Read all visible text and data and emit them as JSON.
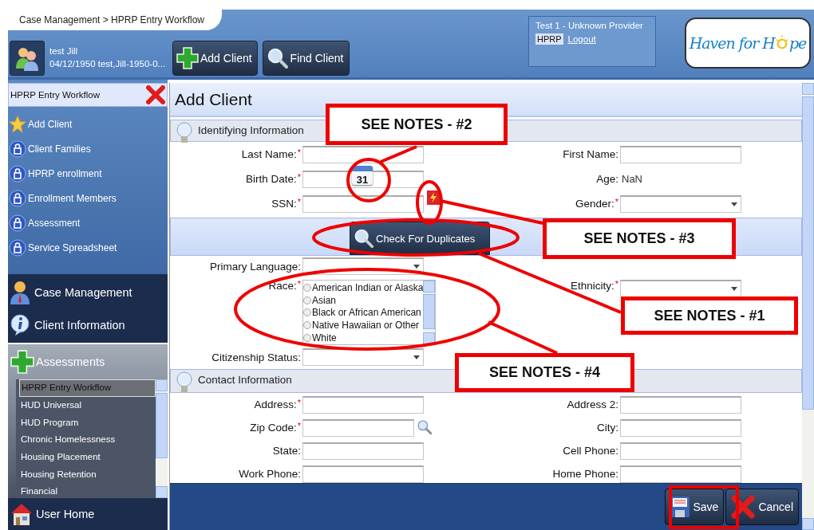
{
  "breadcrumb": "Case Management > HPRP Entry Workflow",
  "client": {
    "name": "test Jill",
    "details": "04/12/1950 test,Jill-1950-0..."
  },
  "toolbar": [
    {
      "label": "Add Client",
      "kind": "add"
    },
    {
      "label": "Find Client",
      "kind": "find"
    }
  ],
  "provider": {
    "name": "Test 1 - Unknown Provider",
    "badge": "HPRP",
    "link": "Logout"
  },
  "logo": {
    "before": "Haven for H",
    "after": "pe"
  },
  "workflow": {
    "title": "HPRP Entry Workflow",
    "items": [
      {
        "label": "Add Client",
        "kind": "star"
      },
      {
        "label": "Client Families",
        "kind": "lock"
      },
      {
        "label": "HPRP enrollment",
        "kind": "lock"
      },
      {
        "label": "Enrollment Members",
        "kind": "lock"
      },
      {
        "label": "Assessment",
        "kind": "lock"
      },
      {
        "label": "Service Spreadsheet",
        "kind": "lock"
      }
    ]
  },
  "nav": [
    {
      "label": "Case Management",
      "kind": "person"
    },
    {
      "label": "Client Information",
      "kind": "info"
    }
  ],
  "assessments": {
    "title": "Assessments",
    "items": [
      {
        "label": "HPRP Entry Workflow",
        "selected": true
      },
      {
        "label": "HUD Universal",
        "selected": false
      },
      {
        "label": "HUD Program",
        "selected": false
      },
      {
        "label": "Chronic Homelessness",
        "selected": false
      },
      {
        "label": "Housing Placement",
        "selected": false
      },
      {
        "label": "Housing Retention",
        "selected": false
      },
      {
        "label": "Financial",
        "selected": false
      }
    ]
  },
  "home": "User Home",
  "page_title": "Add Client",
  "identifying": {
    "title": "Identifying Information",
    "rows": [
      {
        "left": {
          "label": "Last Name:",
          "marker": "*",
          "kind": "text"
        },
        "right": {
          "label": "First Name:",
          "kind": "text"
        }
      },
      {
        "left": {
          "label": "Birth Date:",
          "marker": "*",
          "kind": "date",
          "icon_text": "31"
        },
        "right": {
          "label": "Age:",
          "kind": "value",
          "value": "NaN"
        }
      },
      {
        "left": {
          "label": "SSN:",
          "marker": "*",
          "kind": "ssn"
        },
        "right": {
          "label": "Gender:",
          "marker": "*",
          "kind": "select"
        }
      }
    ]
  },
  "duplicates_button": "Check For Duplicates",
  "demographics": [
    {
      "left": {
        "label": "Primary Language:",
        "kind": "select"
      }
    },
    {
      "left": {
        "label": "Race:",
        "marker": "*",
        "kind": "radiolist",
        "options": [
          {
            "label": "American Indian or Alaska",
            "selected": false
          },
          {
            "label": "Asian",
            "selected": false
          },
          {
            "label": "Black or African American",
            "selected": false
          },
          {
            "label": "Native Hawaiian or Other",
            "selected": false
          },
          {
            "label": "White",
            "selected": false
          }
        ]
      },
      "right": {
        "label": "Ethnicity:",
        "marker": "*",
        "kind": "select"
      }
    },
    {
      "left": {
        "label": "Citizenship Status:",
        "kind": "select"
      }
    }
  ],
  "contact": {
    "title": "Contact Information",
    "rows": [
      {
        "left": {
          "label": "Address:",
          "marker": "*",
          "kind": "text"
        },
        "right": {
          "label": "Address 2:",
          "kind": "text"
        }
      },
      {
        "left": {
          "label": "Zip Code:",
          "marker": "*",
          "kind": "zip"
        },
        "right": {
          "label": "City:",
          "kind": "text"
        }
      },
      {
        "left": {
          "label": "State:",
          "kind": "text"
        },
        "right": {
          "label": "Cell Phone:",
          "kind": "text"
        }
      },
      {
        "left": {
          "label": "Work Phone:",
          "kind": "text"
        },
        "right": {
          "label": "Home Phone:",
          "kind": "text"
        }
      }
    ]
  },
  "footer_buttons": [
    {
      "label": "Save",
      "kind": "save"
    },
    {
      "label": "Cancel",
      "kind": "cancel"
    }
  ],
  "callouts": [
    {
      "text": "SEE NOTES - #2"
    },
    {
      "text": "SEE NOTES - #3"
    },
    {
      "text": "SEE NOTES - #1"
    },
    {
      "text": "SEE NOTES - #4"
    }
  ]
}
